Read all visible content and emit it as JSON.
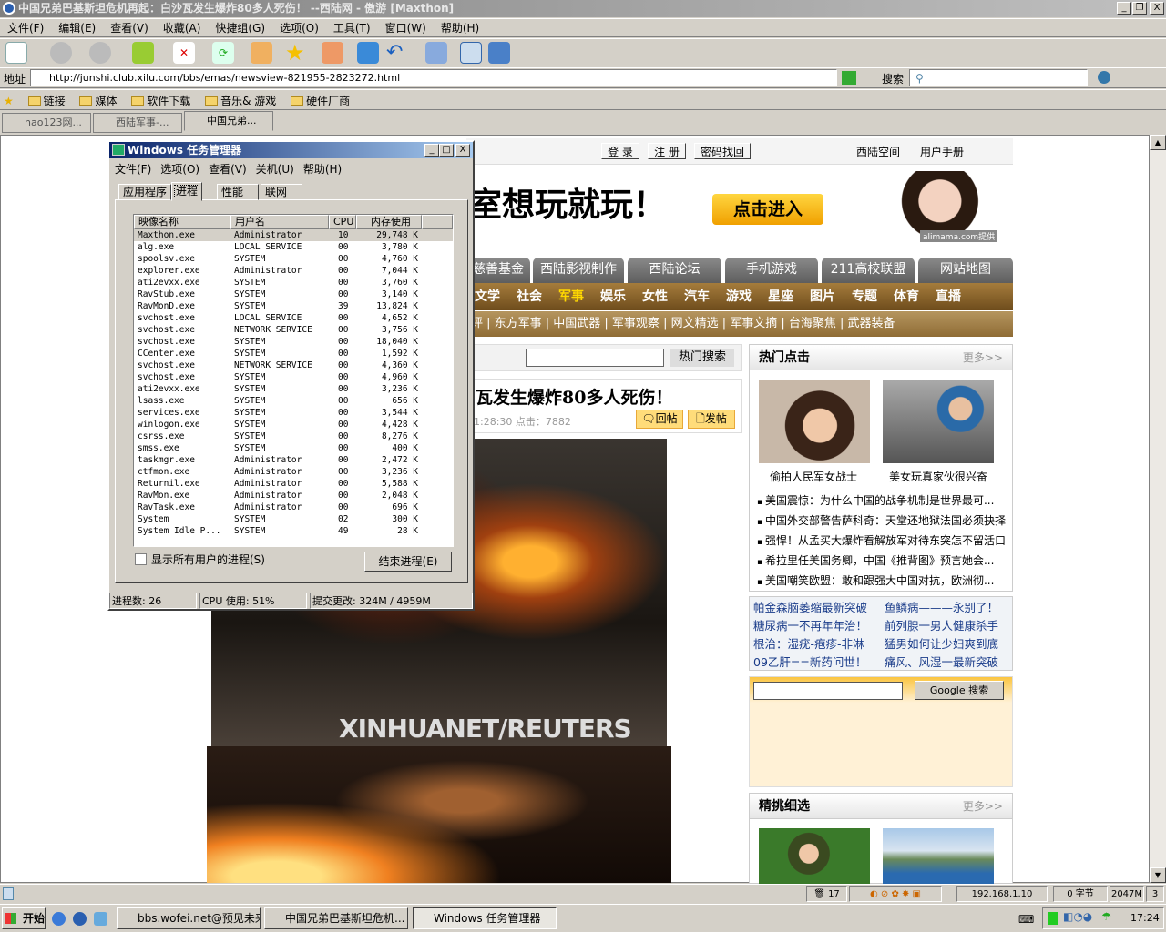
{
  "browser": {
    "title": "中国兄弟巴基斯坦危机再起：白沙瓦发生爆炸80多人死伤！ --西陆网 - 傲游 [Maxthon]",
    "menu": [
      "文件(F)",
      "编辑(E)",
      "查看(V)",
      "收藏(A)",
      "快捷组(G)",
      "选项(O)",
      "工具(T)",
      "窗口(W)",
      "帮助(H)"
    ],
    "address_label": "地址",
    "url": "http://junshi.club.xilu.com/bbs/emas/newsview-821955-2823272.html",
    "search_label": "搜索",
    "favorites": [
      "链接",
      "媒体",
      "软件下载",
      "音乐& 游戏",
      "硬件厂商"
    ],
    "tabs": [
      "hao123网...",
      "西陆军事-...",
      "中国兄弟..."
    ]
  },
  "page": {
    "top_buttons": [
      "登 录",
      "注 册",
      "密码找回"
    ],
    "top_links": [
      "西陆空间",
      "用户手册"
    ],
    "banner_text": "室想玩就玩！",
    "banner_button": "点击进入",
    "ad_credit": "alimama.com提供",
    "gray_tabs": [
      "慈善基金",
      "西陆影视制作",
      "西陆论坛",
      "手机游戏",
      "211高校联盟",
      "网站地图"
    ],
    "main_nav": [
      "文学",
      "社会",
      "军事",
      "娱乐",
      "女性",
      "汽车",
      "游戏",
      "星座",
      "图片",
      "专题",
      "体育",
      "直播"
    ],
    "active_nav": "军事",
    "sub_nav": "军评 | 东方军事 | 中国武器 | 军事观察 | 网文精选 | 军事文摘 | 台海聚焦 | 武器装备",
    "hot_search_button": "热门搜索",
    "headline": "瓦发生爆炸80多人死伤！",
    "meta": "1:28:30 点击：7882",
    "reply_button": "回帖",
    "post_button": "发帖",
    "photo_caption": "XINHUANET/REUTERS",
    "hot": {
      "title": "热门点击",
      "more": "更多>>",
      "captions": [
        "偷拍人民军女战士",
        "美女玩真家伙很兴奋"
      ],
      "items": [
        "美国震惊：为什么中国的战争机制是世界最可...",
        "中国外交部警告萨科奇：天堂还地狱法国必须抉择",
        "强悍！从孟买大爆炸看解放军对待东突怎不留活口",
        "希拉里任美国务卿，中国《推背图》预言她会...",
        "美国嘲笑欧盟：敢和跟强大中国对抗，欧洲彻..."
      ]
    },
    "health_links": [
      "帕金森脑萎缩最新突破",
      "鱼鳞病———永别了！",
      "糖尿病一不再年年治！",
      "前列腺一男人健康杀手",
      "根治：湿疣-疱疹-非淋",
      "猛男如何让少妇爽到底",
      "09乙肝==新药问世！",
      "痛风、风湿一最新突破"
    ],
    "google_button": "Google 搜索",
    "picks": {
      "title": "精挑细选",
      "more": "更多>>"
    }
  },
  "taskmgr": {
    "title": "Windows 任务管理器",
    "menu": [
      "文件(F)",
      "选项(O)",
      "查看(V)",
      "关机(U)",
      "帮助(H)"
    ],
    "tabs": [
      "应用程序",
      "进程",
      "性能",
      "联网"
    ],
    "columns": [
      "映像名称",
      "用户名",
      "CPU",
      "内存使用"
    ],
    "processes": [
      [
        "Maxthon.exe",
        "Administrator",
        "10",
        "29,748 K"
      ],
      [
        "alg.exe",
        "LOCAL SERVICE",
        "00",
        "3,780 K"
      ],
      [
        "spoolsv.exe",
        "SYSTEM",
        "00",
        "4,760 K"
      ],
      [
        "explorer.exe",
        "Administrator",
        "00",
        "7,044 K"
      ],
      [
        "ati2evxx.exe",
        "SYSTEM",
        "00",
        "3,760 K"
      ],
      [
        "RavStub.exe",
        "SYSTEM",
        "00",
        "3,140 K"
      ],
      [
        "RavMonD.exe",
        "SYSTEM",
        "39",
        "13,824 K"
      ],
      [
        "svchost.exe",
        "LOCAL SERVICE",
        "00",
        "4,652 K"
      ],
      [
        "svchost.exe",
        "NETWORK SERVICE",
        "00",
        "3,756 K"
      ],
      [
        "svchost.exe",
        "SYSTEM",
        "00",
        "18,040 K"
      ],
      [
        "CCenter.exe",
        "SYSTEM",
        "00",
        "1,592 K"
      ],
      [
        "svchost.exe",
        "NETWORK SERVICE",
        "00",
        "4,360 K"
      ],
      [
        "svchost.exe",
        "SYSTEM",
        "00",
        "4,960 K"
      ],
      [
        "ati2evxx.exe",
        "SYSTEM",
        "00",
        "3,236 K"
      ],
      [
        "lsass.exe",
        "SYSTEM",
        "00",
        "656 K"
      ],
      [
        "services.exe",
        "SYSTEM",
        "00",
        "3,544 K"
      ],
      [
        "winlogon.exe",
        "SYSTEM",
        "00",
        "4,428 K"
      ],
      [
        "csrss.exe",
        "SYSTEM",
        "00",
        "8,276 K"
      ],
      [
        "smss.exe",
        "SYSTEM",
        "00",
        "400 K"
      ],
      [
        "taskmgr.exe",
        "Administrator",
        "00",
        "2,472 K"
      ],
      [
        "ctfmon.exe",
        "Administrator",
        "00",
        "3,236 K"
      ],
      [
        "Returnil.exe",
        "Administrator",
        "00",
        "5,588 K"
      ],
      [
        "RavMon.exe",
        "Administrator",
        "00",
        "2,048 K"
      ],
      [
        "RavTask.exe",
        "Administrator",
        "00",
        "696 K"
      ],
      [
        "System",
        "SYSTEM",
        "02",
        "300 K"
      ],
      [
        "System Idle P...",
        "SYSTEM",
        "49",
        "28 K"
      ]
    ],
    "show_all": "显示所有用户的进程(S)",
    "end_process": "结束进程(E)",
    "status": [
      "进程数: 26",
      "CPU 使用: 51%",
      "提交更改: 324M / 4959M"
    ]
  },
  "statusbar": {
    "count": "17",
    "ip": "192.168.1.10",
    "bytes": "0 字节",
    "mem": "2047M",
    "num": "3"
  },
  "taskbar": {
    "start": "开始",
    "items": [
      "bbs.wofei.net@预见未来",
      "中国兄弟巴基斯坦危机...",
      "Windows 任务管理器"
    ],
    "clock": "17:24"
  }
}
